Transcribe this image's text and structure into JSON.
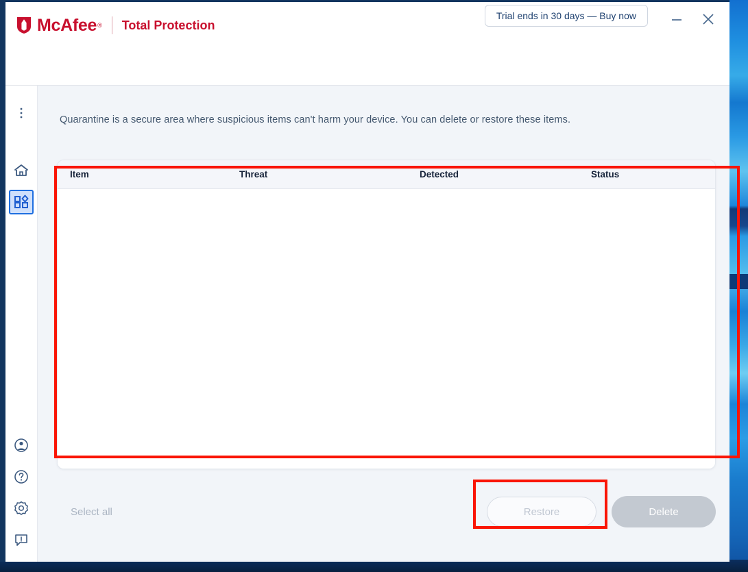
{
  "window": {
    "brand": {
      "logo_icon": "mcafee-shield-icon",
      "name": "McAfee",
      "trademark": "®",
      "product": "Total Protection",
      "brand_color": "#c8102e"
    },
    "trial_banner": {
      "label": "Trial ends in 30 days — Buy now"
    },
    "controls": {
      "minimize_icon": "minimize-icon",
      "close_icon": "close-icon"
    }
  },
  "sidebar": {
    "items": [
      {
        "key": "menu",
        "icon": "kebab-menu-icon",
        "selected": false
      },
      {
        "key": "home",
        "icon": "home-icon",
        "selected": false
      },
      {
        "key": "features",
        "icon": "apps-grid-icon",
        "selected": true
      }
    ],
    "bottom_items": [
      {
        "key": "account",
        "icon": "account-circle-icon",
        "selected": false
      },
      {
        "key": "help",
        "icon": "help-circle-icon",
        "selected": false
      },
      {
        "key": "settings",
        "icon": "gear-icon",
        "selected": false
      },
      {
        "key": "feedback",
        "icon": "feedback-icon",
        "selected": false
      }
    ]
  },
  "main": {
    "description": "Quarantine is a secure area where suspicious items can't harm your device. You can delete or restore these items.",
    "table": {
      "columns": [
        "Item",
        "Threat",
        "Detected",
        "Status"
      ],
      "rows": []
    },
    "actions": {
      "select_all_label": "Select all",
      "restore_label": "Restore",
      "delete_label": "Delete"
    }
  },
  "annotations": {
    "highlight_color": "#fa1505",
    "boxes": [
      "quarantine-table",
      "restore-button"
    ]
  }
}
